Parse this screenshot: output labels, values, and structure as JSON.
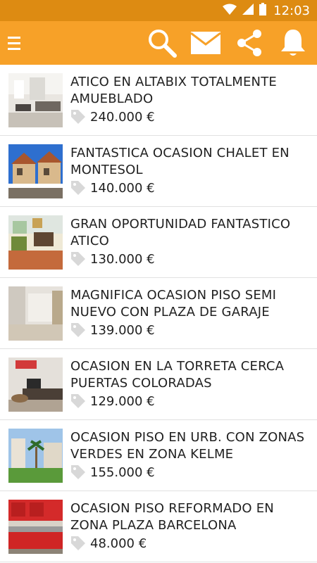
{
  "status_bar": {
    "time": "12:03"
  },
  "toolbar": {
    "menu_icon": "hamburger-menu-icon",
    "actions": [
      "search-icon",
      "mail-icon",
      "share-icon",
      "bell-icon"
    ],
    "color": "#f7a128"
  },
  "listings": [
    {
      "title": "ATICO EN ALTABIX TOTALMENTE AMUEBLADO",
      "price": "240.000 €"
    },
    {
      "title": "FANTASTICA OCASION CHALET EN MONTESOL",
      "price": "140.000 €"
    },
    {
      "title": "GRAN OPORTUNIDAD FANTASTICO ATICO",
      "price": "130.000 €"
    },
    {
      "title": "MAGNIFICA OCASION PISO SEMI NUEVO CON PLAZA DE GARAJE",
      "price": "139.000 €"
    },
    {
      "title": "OCASION EN LA TORRETA CERCA PUERTAS COLORADAS",
      "price": "129.000 €"
    },
    {
      "title": "OCASION PISO EN URB. CON ZONAS VERDES EN ZONA KELME",
      "price": "155.000 €"
    },
    {
      "title": "OCASION PISO REFORMADO EN ZONA PLAZA BARCELONA",
      "price": "48.000 €"
    }
  ]
}
